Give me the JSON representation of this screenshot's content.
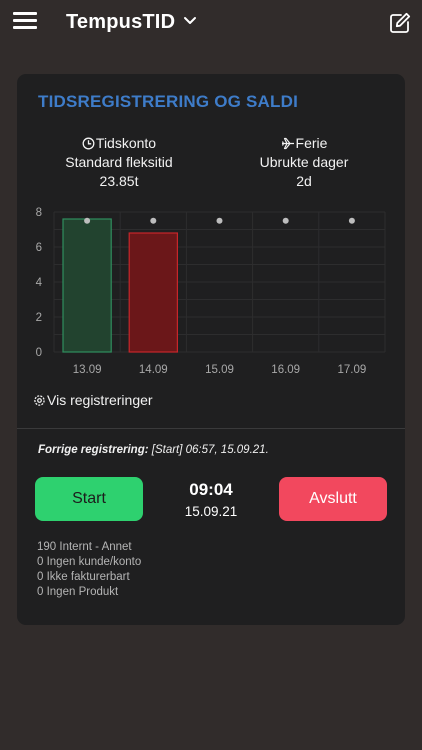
{
  "header": {
    "app_title": "TempusTID",
    "menu_icon": "hamburger-menu-icon",
    "dropdown_icon": "chevron-down-icon",
    "edit_icon": "edit-square-icon"
  },
  "card": {
    "title": "TIDSREGISTRERING OG SALDI",
    "title_color": "#3e7cc9",
    "stats": {
      "left": {
        "icon": "clock-icon",
        "label": "Tidskonto",
        "sublabel": "Standard fleksitid",
        "value": "23.85t"
      },
      "right": {
        "icon": "plane-icon",
        "label": "Ferie",
        "sublabel": "Ubrukte dager",
        "value": "2d"
      }
    },
    "chart_data": {
      "type": "bar",
      "categories": [
        "13.09",
        "14.09",
        "15.09",
        "16.09",
        "17.09"
      ],
      "values": [
        7.6,
        6.8,
        0,
        0,
        0
      ],
      "target": 7.5,
      "bar_colors": [
        "#2f8f5e",
        "#c7262a",
        "",
        "",
        ""
      ],
      "bar_fills": [
        "#22432f",
        "#6b1719",
        "",
        "",
        ""
      ],
      "ylim": [
        0,
        8
      ],
      "yticks": [
        "0",
        "2",
        "4",
        "6",
        "8"
      ],
      "grid": true
    },
    "show_registrations": "Vis registreringer",
    "previous_registration": {
      "label": "Forrige registrering:",
      "value": "[Start] 06:57, 15.09.21."
    },
    "start_label": "Start",
    "stop_label": "Avslutt",
    "start_color": "#2ed16f",
    "stop_color": "#f2485e",
    "current_time": "09:04",
    "current_date": "15.09.21",
    "info_lines": [
      "190 Internt - Annet",
      "0 Ingen kunde/konto",
      "0 Ikke fakturerbart",
      "0 Ingen Produkt"
    ]
  }
}
